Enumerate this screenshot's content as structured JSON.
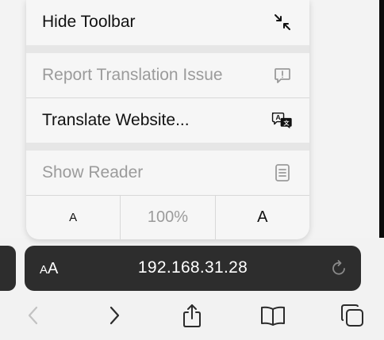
{
  "menu": {
    "hide_toolbar": {
      "label": "Hide Toolbar",
      "icon": "arrows-inward-icon"
    },
    "report_translation": {
      "label": "Report Translation Issue",
      "icon": "exclamation-bubble-icon"
    },
    "translate_website": {
      "label": "Translate Website...",
      "icon": "translate-icon"
    },
    "show_reader": {
      "label": "Show Reader",
      "icon": "reader-page-icon"
    }
  },
  "zoom": {
    "decrease_label": "A",
    "level": "100%",
    "increase_label": "A"
  },
  "address_bar": {
    "aa_label_small": "A",
    "aa_label_large": "A",
    "url": "192.168.31.28",
    "reload_icon": "reload-icon"
  },
  "toolbar": {
    "back_icon": "chevron-left-icon",
    "forward_icon": "chevron-right-icon",
    "share_icon": "share-icon",
    "bookmarks_icon": "book-icon",
    "tabs_icon": "tabs-icon"
  },
  "colors": {
    "disabled_text": "#9b9b9b",
    "address_bar_bg": "#2d2d2d",
    "toolbar_icon": "#2b2b2b",
    "toolbar_icon_disabled": "#c2c2c2"
  }
}
